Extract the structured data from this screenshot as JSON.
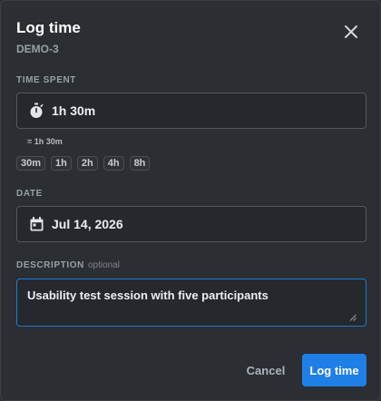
{
  "dialog": {
    "title": "Log time",
    "subtitle": "DEMO-3"
  },
  "time_spent": {
    "label": "TIME SPENT",
    "value": "1h 30m",
    "hint": "= 1h 30m",
    "presets": [
      "30m",
      "1h",
      "2h",
      "4h",
      "8h"
    ],
    "icon": "stopwatch-icon"
  },
  "date": {
    "label": "DATE",
    "value": "Jul 14, 2026",
    "icon": "calendar-icon"
  },
  "description": {
    "label": "DESCRIPTION",
    "optional": "optional",
    "value": "Usability test session with five participants"
  },
  "actions": {
    "cancel": "Cancel",
    "submit": "Log time"
  },
  "colors": {
    "accent": "#1f7fe6",
    "background": "#2b2e33"
  }
}
